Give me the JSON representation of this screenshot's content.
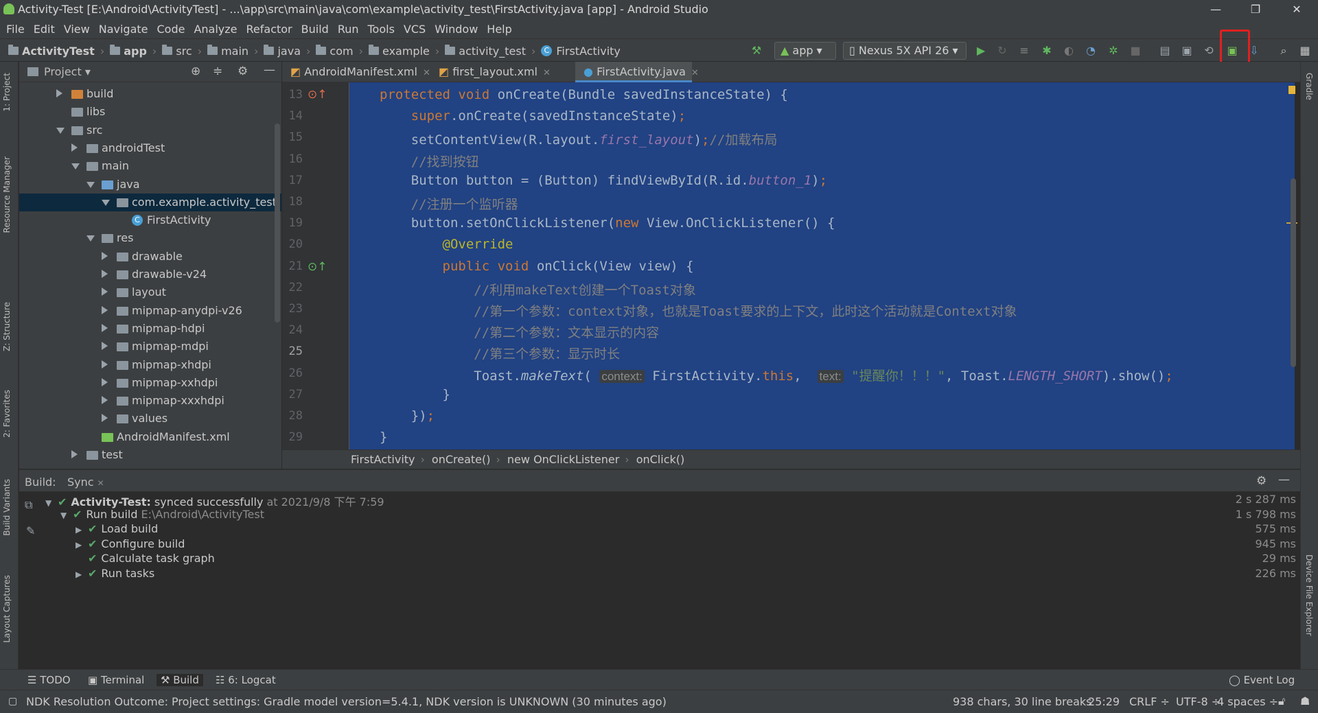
{
  "window": {
    "title": "Activity-Test [E:\\Android\\ActivityTest] - ...\\app\\src\\main\\java\\com\\example\\activity_test\\FirstActivity.java [app] - Android Studio",
    "minimize": "—",
    "restore": "❐",
    "close": "✕"
  },
  "menu": [
    "File",
    "Edit",
    "View",
    "Navigate",
    "Code",
    "Analyze",
    "Refactor",
    "Build",
    "Run",
    "Tools",
    "VCS",
    "Window",
    "Help"
  ],
  "breadcrumbs": [
    "ActivityTest",
    "app",
    "src",
    "main",
    "java",
    "com",
    "example",
    "activity_test",
    "FirstActivity"
  ],
  "toolbar": {
    "run_config": "app",
    "device": "Nexus 5X API 26"
  },
  "project_panel": {
    "title": "Project"
  },
  "tree": [
    {
      "label": "build",
      "depth": 1,
      "arrow": "r",
      "icon": "orange"
    },
    {
      "label": "libs",
      "depth": 1,
      "arrow": "",
      "icon": "grey"
    },
    {
      "label": "src",
      "depth": 1,
      "arrow": "d",
      "icon": "grey"
    },
    {
      "label": "androidTest",
      "depth": 2,
      "arrow": "r",
      "icon": "grey"
    },
    {
      "label": "main",
      "depth": 2,
      "arrow": "d",
      "icon": "grey"
    },
    {
      "label": "java",
      "depth": 3,
      "arrow": "d",
      "icon": "blue"
    },
    {
      "label": "com.example.activity_test",
      "depth": 4,
      "arrow": "d",
      "icon": "grey",
      "selected": true
    },
    {
      "label": "FirstActivity",
      "depth": 5,
      "arrow": "",
      "icon": "class"
    },
    {
      "label": "res",
      "depth": 3,
      "arrow": "d",
      "icon": "grey"
    },
    {
      "label": "drawable",
      "depth": 4,
      "arrow": "r",
      "icon": "grey"
    },
    {
      "label": "drawable-v24",
      "depth": 4,
      "arrow": "r",
      "icon": "grey"
    },
    {
      "label": "layout",
      "depth": 4,
      "arrow": "r",
      "icon": "grey"
    },
    {
      "label": "mipmap-anydpi-v26",
      "depth": 4,
      "arrow": "r",
      "icon": "grey"
    },
    {
      "label": "mipmap-hdpi",
      "depth": 4,
      "arrow": "r",
      "icon": "grey"
    },
    {
      "label": "mipmap-mdpi",
      "depth": 4,
      "arrow": "r",
      "icon": "grey"
    },
    {
      "label": "mipmap-xhdpi",
      "depth": 4,
      "arrow": "r",
      "icon": "grey"
    },
    {
      "label": "mipmap-xxhdpi",
      "depth": 4,
      "arrow": "r",
      "icon": "grey"
    },
    {
      "label": "mipmap-xxxhdpi",
      "depth": 4,
      "arrow": "r",
      "icon": "grey"
    },
    {
      "label": "values",
      "depth": 4,
      "arrow": "r",
      "icon": "grey"
    },
    {
      "label": "AndroidManifest.xml",
      "depth": 3,
      "arrow": "",
      "icon": "manifest"
    },
    {
      "label": "test",
      "depth": 2,
      "arrow": "r",
      "icon": "grey"
    }
  ],
  "editor_tabs": [
    {
      "label": "AndroidManifest.xml"
    },
    {
      "label": "first_layout.xml"
    },
    {
      "label": "FirstActivity.java",
      "active": true
    }
  ],
  "line_numbers": [
    "13",
    "14",
    "15",
    "16",
    "17",
    "18",
    "19",
    "20",
    "21",
    "22",
    "23",
    "24",
    "25",
    "26",
    "27",
    "28",
    "29"
  ],
  "code_lines": [
    "protected void onCreate(Bundle savedInstanceState) {",
    "    super.onCreate(savedInstanceState);",
    "    setContentView(R.layout.first_layout);//加载布局",
    "    //找到按钮",
    "    Button button = (Button) findViewById(R.id.button_1);",
    "    //注册一个监听器",
    "    button.setOnClickListener(new View.OnClickListener() {",
    "        @Override",
    "        public void onClick(View view) {",
    "            //利用makeText创建一个Toast对象",
    "            //第一个参数：context对象，也就是Toast要求的上下文，此时这个活动就是Context对象",
    "            //第二个参数：文本显示的内容",
    "            //第三个参数：显示时长",
    "            Toast.makeText( context: FirstActivity.this,  text: \"提醒你！！！\", Toast.LENGTH_SHORT).show();",
    "        }",
    "    });",
    "}"
  ],
  "editor_breadcrumb": [
    "FirstActivity",
    "onCreate()",
    "new OnClickListener",
    "onClick()"
  ],
  "build": {
    "tab_build": "Build:",
    "tab_sync": "Sync",
    "rows": [
      {
        "text": "Activity-Test:",
        "extra": "synced successfully",
        "muted": "at 2021/9/8 下午 7:59",
        "time": "2 s 287 ms",
        "indent": 0,
        "arrow": "d"
      },
      {
        "text": "Run build",
        "extra": "",
        "muted": "E:\\Android\\ActivityTest",
        "time": "1 s 798 ms",
        "indent": 1,
        "arrow": "d"
      },
      {
        "text": "Load build",
        "extra": "",
        "muted": "",
        "time": "575 ms",
        "indent": 2,
        "arrow": "r"
      },
      {
        "text": "Configure build",
        "extra": "",
        "muted": "",
        "time": "945 ms",
        "indent": 2,
        "arrow": "r"
      },
      {
        "text": "Calculate task graph",
        "extra": "",
        "muted": "",
        "time": "29 ms",
        "indent": 2,
        "arrow": ""
      },
      {
        "text": "Run tasks",
        "extra": "",
        "muted": "",
        "time": "226 ms",
        "indent": 2,
        "arrow": "r"
      }
    ]
  },
  "side_tabs_left": [
    "1: Project",
    "Resource Manager",
    "Z: Structure",
    "2: Favorites",
    "Build Variants",
    "Layout Captures"
  ],
  "side_tabs_right": [
    "Gradle",
    "Device File Explorer"
  ],
  "bottom_tabs": {
    "todo": "TODO",
    "terminal": "Terminal",
    "build": "Build",
    "logcat": "6: Logcat",
    "event_log": "Event Log"
  },
  "status": {
    "message": "NDK Resolution Outcome: Project settings: Gradle model version=5.4.1, NDK version is UNKNOWN (30 minutes ago)",
    "chars": "938 chars, 30 line breaks",
    "pos": "25:29",
    "crlf": "CRLF ÷",
    "enc": "UTF-8 ÷",
    "indent": "4 spaces ÷"
  }
}
